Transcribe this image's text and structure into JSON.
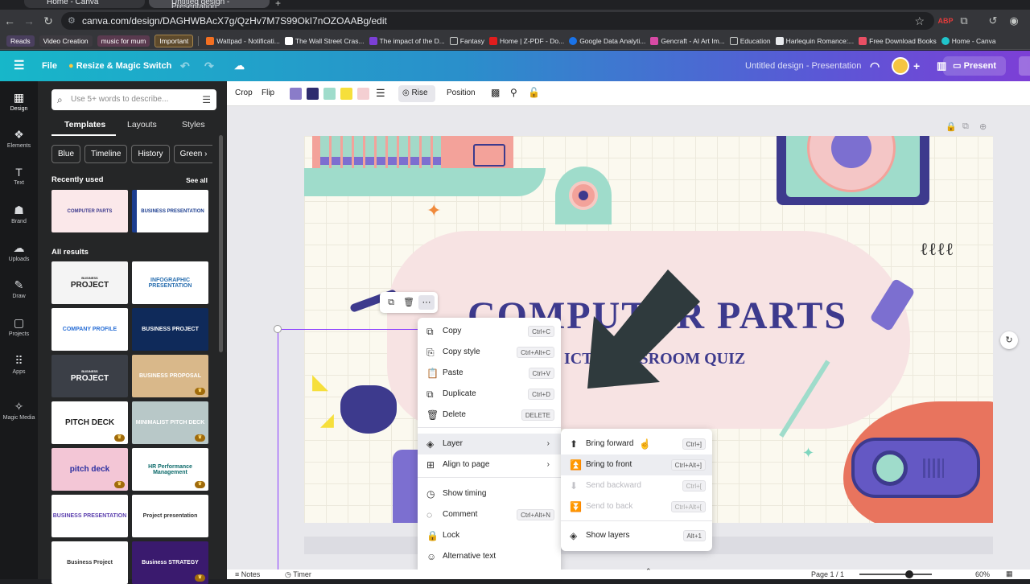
{
  "browser": {
    "tabs": [
      {
        "title": "Home - Canva"
      },
      {
        "title": "Untitled design - Presentation"
      }
    ],
    "url": "canva.com/design/DAGHWBAcX7g/QzHv7M7S99OkI7nOZOAABg/edit",
    "bookmarks_chips": [
      "Reads",
      "Video Creation",
      "music for mum",
      "Important"
    ],
    "bookmarks": [
      {
        "label": "Wattpad - Notificati...",
        "color": "#f36f21"
      },
      {
        "label": "The Wall Street Cras...",
        "color": "#ffffff"
      },
      {
        "label": "The impact of the D...",
        "color": "#7b3fd6"
      },
      {
        "label": "Fantasy",
        "color": "#c4c7c5"
      },
      {
        "label": "Home | Z-PDF - Do...",
        "color": "#e11d1d"
      },
      {
        "label": "Google Data Analyti...",
        "color": "#1a73e8"
      },
      {
        "label": "Gencraft - AI Art Im...",
        "color": "#d84aa5"
      },
      {
        "label": "Education",
        "color": "#c4c7c5"
      },
      {
        "label": "Harlequin Romance:...",
        "color": "#e8eaed"
      },
      {
        "label": "Free Download Books",
        "color": "#e94f64"
      },
      {
        "label": "Home - Canva",
        "color": "#20c4cb"
      }
    ]
  },
  "canva_header": {
    "file_label": "File",
    "resize_label": "Resize & Magic Switch",
    "doc_title": "Untitled design - Presentation",
    "present_label": "Present"
  },
  "rail": [
    {
      "label": "Design",
      "icon": "design-icon",
      "glyph": "▦"
    },
    {
      "label": "Elements",
      "icon": "elements-icon",
      "glyph": "❖"
    },
    {
      "label": "Text",
      "icon": "text-icon",
      "glyph": "T"
    },
    {
      "label": "Brand",
      "icon": "brand-icon",
      "glyph": "☗"
    },
    {
      "label": "Uploads",
      "icon": "uploads-icon",
      "glyph": "☁"
    },
    {
      "label": "Draw",
      "icon": "draw-icon",
      "glyph": "✎"
    },
    {
      "label": "Projects",
      "icon": "projects-icon",
      "glyph": "▢"
    },
    {
      "label": "Apps",
      "icon": "apps-icon",
      "glyph": "⠿"
    },
    {
      "label": "Magic Media",
      "icon": "magic-media-icon",
      "glyph": "✧"
    }
  ],
  "panel": {
    "search_placeholder": "Use 5+ words to describe...",
    "tabs": [
      "Templates",
      "Layouts",
      "Styles"
    ],
    "chips": [
      "Blue",
      "Timeline",
      "History",
      "Green"
    ],
    "recently_used": "Recently used",
    "see_all": "See all",
    "all_results": "All results",
    "recent_thumbs": [
      {
        "title": "COMPUTER PARTS",
        "bg": "#fbe8ea",
        "fg": "#3d3a8d"
      },
      {
        "title": "BUSINESS PRESENTATION",
        "bg": "#ffffff",
        "fg": "#1b3d8f"
      }
    ],
    "result_thumbs": [
      {
        "title": "PROJECT",
        "kicker": "BUSINESS",
        "bg": "#f4f4f4",
        "fg": "#222",
        "crown": false
      },
      {
        "title": "INFOGRAPHIC PRESENTATION",
        "kicker": "",
        "bg": "#ffffff",
        "fg": "#2a6fb0",
        "crown": false
      },
      {
        "title": "COMPANY PROFILE",
        "kicker": "",
        "bg": "#ffffff",
        "fg": "#2a6fd6",
        "crown": false
      },
      {
        "title": "BUSINESS PROJECT",
        "kicker": "",
        "bg": "#0f2a5a",
        "fg": "#ffffff",
        "crown": false
      },
      {
        "title": "PROJECT",
        "kicker": "BUSINESS",
        "bg": "#3b3f47",
        "fg": "#ffffff",
        "crown": false
      },
      {
        "title": "BUSINESS PROPOSAL",
        "kicker": "",
        "bg": "#d9b88a",
        "fg": "#ffffff",
        "crown": true
      },
      {
        "title": "PITCH DECK",
        "kicker": "",
        "bg": "#ffffff",
        "fg": "#222",
        "crown": true
      },
      {
        "title": "MINIMALIST PITCH DECK",
        "kicker": "",
        "bg": "#b8c8c8",
        "fg": "#ffffff",
        "crown": true
      },
      {
        "title": "pitch deck",
        "kicker": "",
        "bg": "#f3c6d6",
        "fg": "#2b2fa0",
        "crown": true
      },
      {
        "title": "HR Performance Management",
        "kicker": "",
        "bg": "#ffffff",
        "fg": "#0d6b6b",
        "crown": true
      },
      {
        "title": "BUSINESS PRESENTATION",
        "kicker": "",
        "bg": "#ffffff",
        "fg": "#5b3fae",
        "crown": false
      },
      {
        "title": "Project presentation",
        "kicker": "",
        "bg": "#ffffff",
        "fg": "#333",
        "crown": false
      },
      {
        "title": "Business Project",
        "kicker": "",
        "bg": "#ffffff",
        "fg": "#333",
        "crown": false
      },
      {
        "title": "Business STRATEGY",
        "kicker": "",
        "bg": "#3a1a6e",
        "fg": "#ffffff",
        "crown": true
      }
    ]
  },
  "toolbar": {
    "crop": "Crop",
    "flip": "Flip",
    "rise": "Rise",
    "position": "Position",
    "swatches": [
      "#8a7cc9",
      "#2e2c6e",
      "#9fdccb",
      "#f6df3b",
      "#f4cfd2"
    ]
  },
  "slide": {
    "title": "COMPUTER PARTS",
    "subtitle": "ICT CLASSROOM QUIZ"
  },
  "context_menu": [
    {
      "label": "Copy",
      "shortcut": "Ctrl+C",
      "icon": "copy-icon",
      "glyph": "⧉"
    },
    {
      "label": "Copy style",
      "shortcut": "Ctrl+Alt+C",
      "icon": "copy-style-icon",
      "glyph": "⎘"
    },
    {
      "label": "Paste",
      "shortcut": "Ctrl+V",
      "icon": "paste-icon",
      "glyph": "📋"
    },
    {
      "label": "Duplicate",
      "shortcut": "Ctrl+D",
      "icon": "duplicate-icon",
      "glyph": "⧉"
    },
    {
      "label": "Delete",
      "shortcut": "DELETE",
      "icon": "trash-icon",
      "glyph": "🗑"
    },
    {
      "label": "Layer",
      "shortcut": "",
      "icon": "layer-icon",
      "glyph": "◈",
      "submenu": true
    },
    {
      "label": "Align to page",
      "shortcut": "",
      "icon": "align-icon",
      "glyph": "⊞",
      "submenu": true
    },
    {
      "label": "Show timing",
      "shortcut": "",
      "icon": "clock-icon",
      "glyph": "◷"
    },
    {
      "label": "Comment",
      "shortcut": "Ctrl+Alt+N",
      "icon": "comment-icon",
      "glyph": "◌"
    },
    {
      "label": "Lock",
      "shortcut": "",
      "icon": "lock-icon",
      "glyph": "🔒"
    },
    {
      "label": "Alternative text",
      "shortcut": "",
      "icon": "accessibility-icon",
      "glyph": "☺"
    }
  ],
  "layer_submenu": [
    {
      "label": "Bring forward",
      "shortcut": "Ctrl+]",
      "icon": "bring-forward-icon",
      "glyph": "⬆",
      "disabled": false
    },
    {
      "label": "Bring to front",
      "shortcut": "Ctrl+Alt+]",
      "icon": "bring-to-front-icon",
      "glyph": "⏫",
      "disabled": false
    },
    {
      "label": "Send backward",
      "shortcut": "Ctrl+[",
      "icon": "send-backward-icon",
      "glyph": "⬇",
      "disabled": true
    },
    {
      "label": "Send to back",
      "shortcut": "Ctrl+Alt+[",
      "icon": "send-to-back-icon",
      "glyph": "⏬",
      "disabled": true
    },
    {
      "label": "Show layers",
      "shortcut": "Alt+1",
      "icon": "layers-icon",
      "glyph": "◈",
      "disabled": false
    }
  ],
  "bottom": {
    "notes": "Notes",
    "timer": "Timer",
    "page": "Page 1 / 1",
    "zoom": "60%"
  }
}
